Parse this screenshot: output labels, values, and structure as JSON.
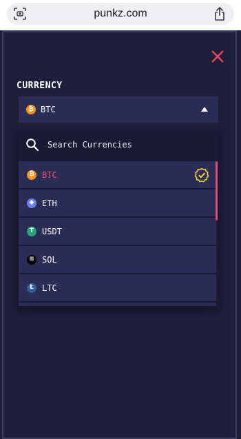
{
  "browser": {
    "url": "punkz.com",
    "icons": {
      "left": "scan-icon",
      "right": "share-icon"
    }
  },
  "modal": {
    "close_icon": "close-icon",
    "currency_label": "CURRENCY",
    "select": {
      "value": "BTC",
      "icon": "btc-icon",
      "state": "open"
    },
    "search": {
      "placeholder": "Search Currencies",
      "value": ""
    },
    "options": [
      {
        "label": "BTC",
        "icon": "btc-icon",
        "color": "#f7931a",
        "glyph": "₿",
        "selected": true
      },
      {
        "label": "ETH",
        "icon": "eth-icon",
        "color": "#6c7ff2",
        "glyph": "◆",
        "selected": false
      },
      {
        "label": "USDT",
        "icon": "usdt-icon",
        "color": "#26a17b",
        "glyph": "T",
        "selected": false
      },
      {
        "label": "SOL",
        "icon": "sol-icon",
        "color": "#000000",
        "glyph": "≡",
        "selected": false
      },
      {
        "label": "LTC",
        "icon": "ltc-icon",
        "color": "#345d9d",
        "glyph": "Ł",
        "selected": false
      }
    ]
  },
  "colors": {
    "background": "#1d1f3b",
    "panel": "#2a2d55",
    "accent_red": "#ff4d6a",
    "check_yellow": "#f5d33a"
  }
}
